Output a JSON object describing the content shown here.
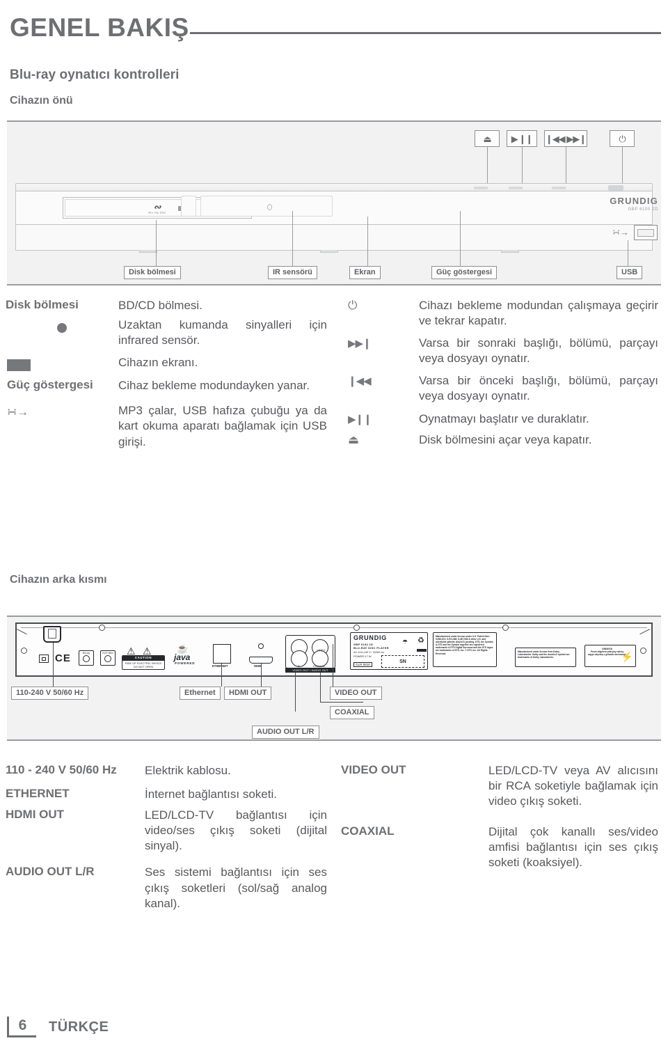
{
  "header": {
    "title": "GENEL BAKIŞ"
  },
  "sections": {
    "controls_heading": "Blu-ray oynatıcı kontrolleri",
    "front_heading": "Cihazın önü",
    "rear_heading": "Cihazın arka kısmı"
  },
  "front_diagram": {
    "buttons": [
      {
        "name": "eject-button",
        "glyph": "⏏"
      },
      {
        "name": "play-pause-button",
        "glyph": "▶ ❙❙"
      },
      {
        "name": "prev-next-button",
        "glyph": "❙◀◀ ▶▶❙"
      },
      {
        "name": "power-button",
        "glyph": "⏻"
      }
    ],
    "callouts": [
      {
        "name": "callout-disk-bolmesi",
        "label": "Disk bölmesi"
      },
      {
        "name": "callout-ir-sensoru",
        "label": "IR sensörü"
      },
      {
        "name": "callout-ekran",
        "label": "Ekran"
      },
      {
        "name": "callout-guc-gostergesi",
        "label": "Güç göstergesi"
      },
      {
        "name": "callout-usb",
        "label": "USB"
      }
    ],
    "brand": "GRUNDIG",
    "model": "GBP 6100 2D",
    "bd_logo_text": "Blu-ray Disc"
  },
  "front_table": [
    {
      "key": "Disk bölmesi",
      "icon": "none",
      "value": "BD/CD bölmesi."
    },
    {
      "key": "",
      "icon": "circle",
      "value": "Uzaktan kumanda sinyalleri için infrared sensör."
    },
    {
      "key": "",
      "icon": "rect",
      "value": "Cihazın ekranı."
    },
    {
      "key": "Güç göstergesi",
      "icon": "none",
      "value": "Cihaz bekleme modundayken yanar."
    },
    {
      "key": "",
      "icon": "usb",
      "value": "MP3 çalar, USB hafıza çubuğu ya da kart okuma aparatı bağlamak için USB girişi."
    }
  ],
  "front_table_right": [
    {
      "icon": "power",
      "glyph": "⏻",
      "value": "Cihazı bekleme modundan çalışmaya geçirir ve tekrar kapatır."
    },
    {
      "icon": "next",
      "glyph": "▶▶❙",
      "value": "Varsa bir sonraki başlığı, bölümü, parçayı veya dosyayı oynatır."
    },
    {
      "icon": "prev",
      "glyph": "❙◀◀",
      "value": "Varsa bir önceki başlığı, bölümü, parçayı veya dosyayı oynatır."
    },
    {
      "icon": "play-pause",
      "glyph": "▶❙❙",
      "value": "Oynatmayı başlatır ve duraklatır."
    },
    {
      "icon": "eject",
      "glyph": "⏏",
      "value": "Disk bölmesini açar veya kapatır."
    }
  ],
  "rear_diagram": {
    "callouts": [
      {
        "name": "callout-power-input",
        "label": "110-240 V 50/60 Hz"
      },
      {
        "name": "callout-ethernet",
        "label": "Ethernet"
      },
      {
        "name": "callout-hdmi-out",
        "label": "HDMI OUT"
      },
      {
        "name": "callout-video-out",
        "label": "VIDEO OUT"
      },
      {
        "name": "callout-coaxial",
        "label": "COAXIAL"
      },
      {
        "name": "callout-audio-out",
        "label": "AUDIO OUT L/R"
      }
    ],
    "port_labels": {
      "ethernet": "ETHERNET",
      "hdmi": "HDMI",
      "video_audio_out": "VIDEO OUT / AUDIO OUT",
      "video": "VIDEO",
      "coaxial": "COAXIAL",
      "right": "R",
      "left": "L"
    },
    "caution": {
      "title": "CAUTION",
      "line1": "RISK OF ELECTRIC SHOCK",
      "line2": "DO NOT OPEN"
    },
    "java": {
      "name": "java",
      "sub": "POWERED"
    },
    "ce": "CE",
    "disc_badges": [
      "Blu-ray",
      "DVD Video"
    ],
    "rating_plate": {
      "brand": "GRUNDIG",
      "model": "GBP 6100 2D",
      "type": "BLU-RAY DISC PLAYER",
      "voltage": "AC:110-240 V~  50/60 Hz",
      "power": "POWER:17 W",
      "code": "GLR 5810",
      "sn": "SN"
    },
    "dts_notice": "Manufactured under license under U.S. Patent Nos: 5,956,674; 5,974,380; 6,487,535 & other U.S. and worldwide patents issued & pending. DTS, the Symbol, & DTS and the Symbol together are registered trademarks & DTS Digital Surround and the DTS logos are trademarks of DTS, Inc. © DTS, Inc. All Rights Reserved.",
    "dolby_notice": "Manufactured under license from Dolby Laboratories. Dolby and the double-D symbol are trademarks of Dolby Laboratories.",
    "uwaga": {
      "title": "UWAGA",
      "text": "Przed zdjęciem pokrywy należy wyjąć wtyczkę z gniazda sieciowego"
    }
  },
  "rear_table_left": [
    {
      "key": "110 - 240 V 50/60 Hz",
      "value": "Elektrik kablosu."
    },
    {
      "key": "ETHERNET",
      "value": "İnternet bağlantısı soketi."
    },
    {
      "key": "HDMI OUT",
      "value": "LED/LCD-TV bağlantısı için video/ses çıkış soketi (dijital sinyal)."
    },
    {
      "key": "AUDIO OUT L/R",
      "value": "Ses sistemi bağlantısı için ses çıkış soketleri (sol/sağ analog kanal)."
    }
  ],
  "rear_table_right": [
    {
      "key": "VIDEO OUT",
      "value": "LED/LCD-TV veya AV alıcısını bir RCA soketiyle bağlamak için video çıkış soketi."
    },
    {
      "key": "COAXIAL",
      "value": "Dijital çok kanallı ses/video amfisi bağlantısı için ses çıkış soketi (koaksiyel)."
    }
  ],
  "footer": {
    "page": "6",
    "language": "TÜRKÇE"
  },
  "colors": {
    "heading": "#6e6f72",
    "body": "#58595c",
    "diagram_bg": "#f2f2f2",
    "rear_outline": "#26272a"
  }
}
